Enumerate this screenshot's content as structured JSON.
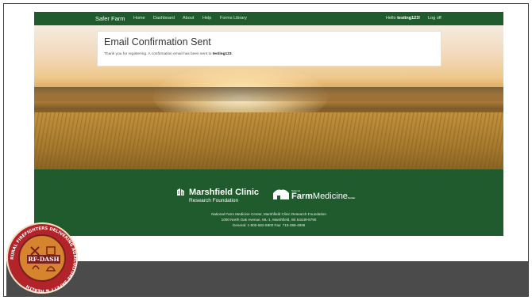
{
  "navbar": {
    "brand": "Safer Farm",
    "items": [
      "Home",
      "Dashboard",
      "About",
      "Help",
      "Forms Library"
    ],
    "greeting_prefix": "Hello ",
    "username": "testing123!",
    "logoff": "Log off"
  },
  "card": {
    "title": "Email Confirmation Sent",
    "message_prefix": "Thank you for registering. A confirmation email has been sent to ",
    "message_user": "testing123",
    "message_suffix": "."
  },
  "footer": {
    "mc_name": "Marshfield Clinic",
    "mc_sub": "Research Foundation",
    "nfmc_small": "National",
    "nfmc_farm": "Farm",
    "nfmc_medicine": "Medicine",
    "nfmc_center": "Center",
    "address_lines": [
      "National Farm Medicine Center, Marshfield Clinic Research Foundation",
      "1000 North Oak Avenue, ML-1, Marshfield, WI 54449-5790",
      "General: 1-800-662-6900 Fax: 715-389-4996"
    ]
  },
  "badge": {
    "label": "RF-DASH",
    "ring_text": "RURAL FIREFIGHTERS DELIVERING AGRICULTURE SAFETY & HEALTH"
  },
  "colors": {
    "nav_green": "#1f5b2c",
    "badge_red": "#b3232a",
    "badge_orange": "#d6842d",
    "bottom_bar": "#4b4b4b"
  }
}
